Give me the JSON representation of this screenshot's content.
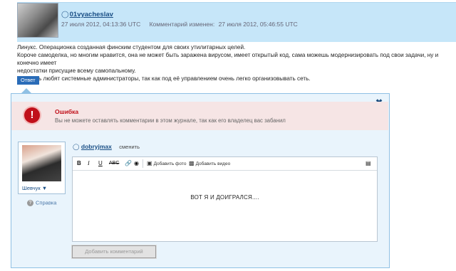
{
  "comment": {
    "username": "01vyacheslav",
    "posted_at": "27 июля 2012, 04:13:36 UTC",
    "edited_label": "Комментарий изменен:",
    "edited_at": "27 июля 2012, 05:46:55 UTC",
    "lines": [
      "Линукс. Операционка созданная финским студентом для своих утилитарных целей.",
      "Короче самоделка, но многим нравится, она не может быть заражена вирусом, имеет открытый код, сама можешь модернизировать под свои задачи, ну и конечно имеет",
      "недостатки присущие всему самопальному.",
      "Её очень любят системные администраторы, так как под её управлением очень легко организовывать сеть."
    ],
    "reply_label": "Ответ"
  },
  "error": {
    "title": "Ошибка",
    "message": "Вы не можете оставлять комментарии в этом журнале, так как его владелец вас забанил"
  },
  "composer": {
    "username": "dobryjmax",
    "change_label": "сменить",
    "userpic_label": "Шевчук ▼",
    "help_label": "Справка",
    "toolbar": {
      "bold": "B",
      "italic": "I",
      "underline": "U",
      "strike": "ABC",
      "add_photo": "Добавить фото",
      "add_video": "Добавить видео"
    },
    "text": "ВОТ Я И ДОИГРАЛСЯ....",
    "submit_label": "Добавить комментарий"
  },
  "colors": {
    "header_bg": "#c6e6f9",
    "link": "#1a4f86",
    "error_red": "#c0101a",
    "panel_bg": "#e9f4fc"
  }
}
